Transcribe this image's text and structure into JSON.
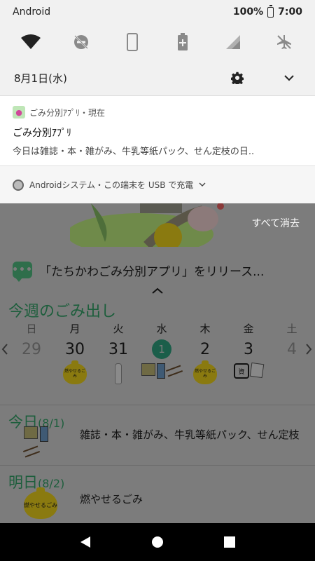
{
  "status_bar": {
    "carrier": "Android",
    "battery": "100%",
    "time": "7:00"
  },
  "quick_settings": {
    "icons": [
      "wifi-icon",
      "do-not-disturb-off-icon",
      "auto-rotate-icon",
      "battery-saver-icon",
      "cellular-signal-icon",
      "airplane-mode-icon"
    ]
  },
  "shade": {
    "date": "8月1日(水)"
  },
  "notification": {
    "app_name": "ごみ分別ｱﾌﾟﾘ・現在",
    "title": "ごみ分別ｱﾌﾟﾘ",
    "text": "今日は雑誌・本・雑がみ、牛乳等紙パック、せん定枝の日..",
    "app_icon_glyph": "●"
  },
  "system_notification": {
    "text": "Androidシステム・この端末を USB で充電"
  },
  "clear_all": "すべて消去",
  "app": {
    "news": "「たちかわごみ分別アプリ」をリリース...",
    "chat_icon_glyph": "•••",
    "week_title": "今週のごみ出し",
    "days_of_week": [
      "日",
      "月",
      "火",
      "水",
      "木",
      "金",
      "土"
    ],
    "days": [
      {
        "num": "29",
        "items": []
      },
      {
        "num": "30",
        "items": [
          "burnable"
        ]
      },
      {
        "num": "31",
        "items": [
          "pet-bottle"
        ]
      },
      {
        "num": "1",
        "items": [
          "paper",
          "carton",
          "branches"
        ]
      },
      {
        "num": "2",
        "items": [
          "burnable"
        ]
      },
      {
        "num": "3",
        "items": [
          "recycle",
          "newspaper"
        ]
      },
      {
        "num": "4",
        "items": []
      }
    ],
    "bag_label": "燃やせるごみ",
    "recycle_label": "資",
    "today": {
      "title": "今日",
      "date": "(8/1)",
      "text": "雑誌・本・雑がみ、牛乳等紙パック、せん定枝"
    },
    "tomorrow": {
      "title": "明日",
      "date": "(8/2)",
      "text": "燃やせるごみ"
    }
  },
  "colors": {
    "accent_green": "#1d5e3c",
    "bag_yellow": "#8a7a10",
    "shade_bg": "#f1f1f1"
  }
}
